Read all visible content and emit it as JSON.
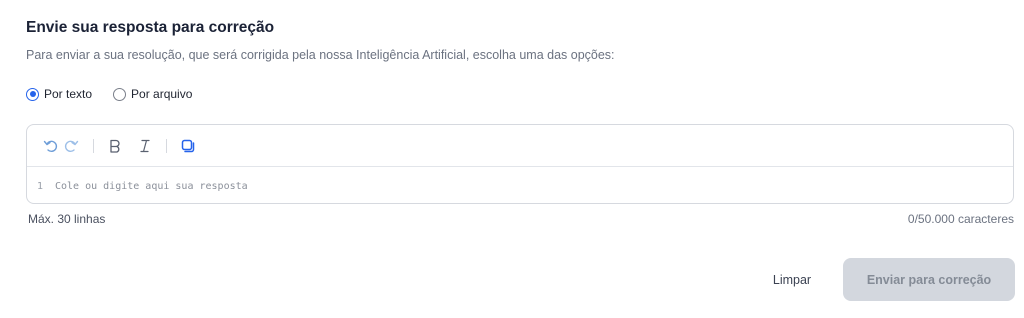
{
  "header": {
    "title": "Envie sua resposta para correção",
    "subtitle": "Para enviar a sua resolução, que será corrigida pela nossa Inteligência Artificial, escolha uma das opções:"
  },
  "submission_mode": {
    "options": [
      {
        "label": "Por texto",
        "selected": true
      },
      {
        "label": "Por arquivo",
        "selected": false
      }
    ]
  },
  "editor": {
    "toolbar": {
      "icons": [
        "undo-icon",
        "redo-icon",
        "bold-icon",
        "italic-icon",
        "copy-icon"
      ]
    },
    "line_number": "1",
    "placeholder": "Cole ou digite aqui sua resposta"
  },
  "footer": {
    "max_lines": "Máx. 30 linhas",
    "char_count": "0/50.000 caracteres"
  },
  "actions": {
    "clear_label": "Limpar",
    "submit_label": "Enviar para correção",
    "submit_disabled": true
  },
  "colors": {
    "accent": "#2563eb",
    "disabled_button_bg": "#d3d7de",
    "disabled_button_text": "#848b96"
  }
}
